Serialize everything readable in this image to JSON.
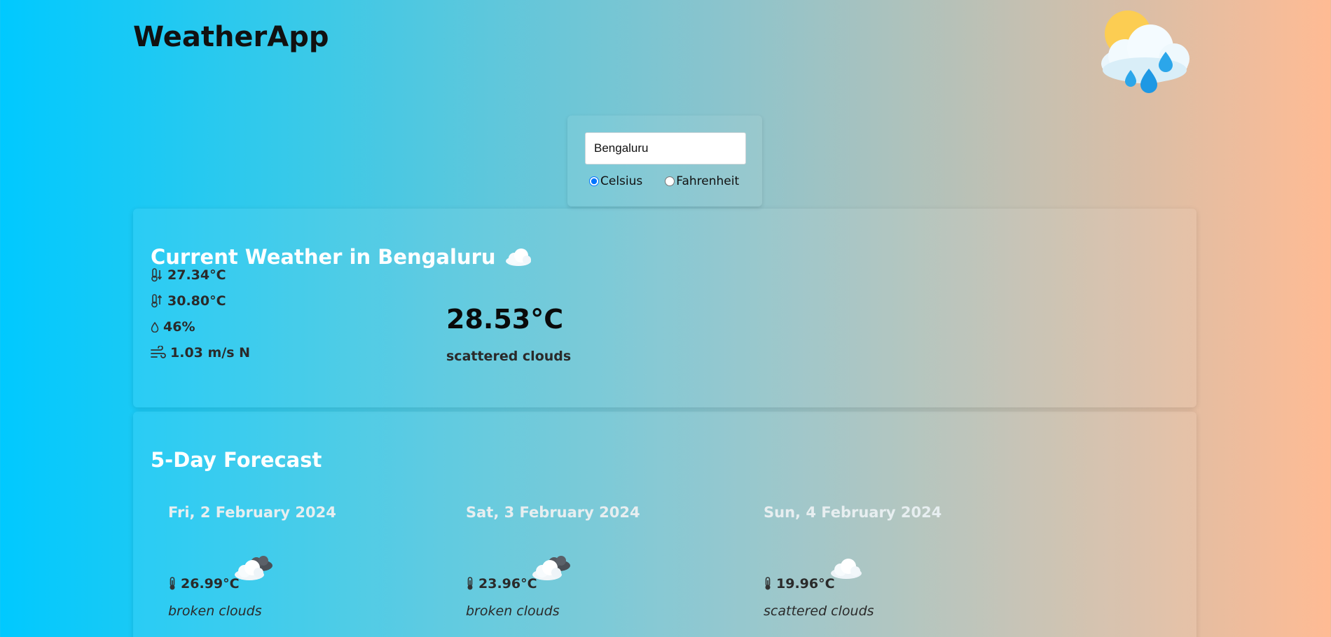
{
  "app": {
    "title": "WeatherApp"
  },
  "search": {
    "value": "Bengaluru",
    "units": [
      {
        "label": "Celsius",
        "selected": true
      },
      {
        "label": "Fahrenheit",
        "selected": false
      }
    ]
  },
  "current": {
    "title": "Current Weather in Bengaluru",
    "min_temp": "27.34°C",
    "max_temp": "30.80°C",
    "humidity": "46%",
    "wind": "1.03 m/s N",
    "temperature": "28.53°C",
    "condition": "scattered clouds"
  },
  "forecast": {
    "title": "5-Day Forecast",
    "days": [
      {
        "date": "Fri, 2 February 2024",
        "temp": "26.99°C",
        "desc": "broken clouds",
        "icon": "broken-clouds-icon"
      },
      {
        "date": "Sat, 3 February 2024",
        "temp": "23.96°C",
        "desc": "broken clouds",
        "icon": "broken-clouds-icon"
      },
      {
        "date": "Sun, 4 February 2024",
        "temp": "19.96°C",
        "desc": "scattered clouds",
        "icon": "scattered-clouds-icon"
      }
    ]
  },
  "icons": {
    "logo": "sun-cloud-rain-icon",
    "title_cloud": "cloud-icon",
    "min_temp": "thermometer-down-icon",
    "max_temp": "thermometer-up-icon",
    "humidity": "droplet-icon",
    "wind": "wind-icon"
  },
  "colors": {
    "gradient_start": "#00c9ff",
    "gradient_end": "#ffbb94",
    "card_title": "#ffffff"
  }
}
